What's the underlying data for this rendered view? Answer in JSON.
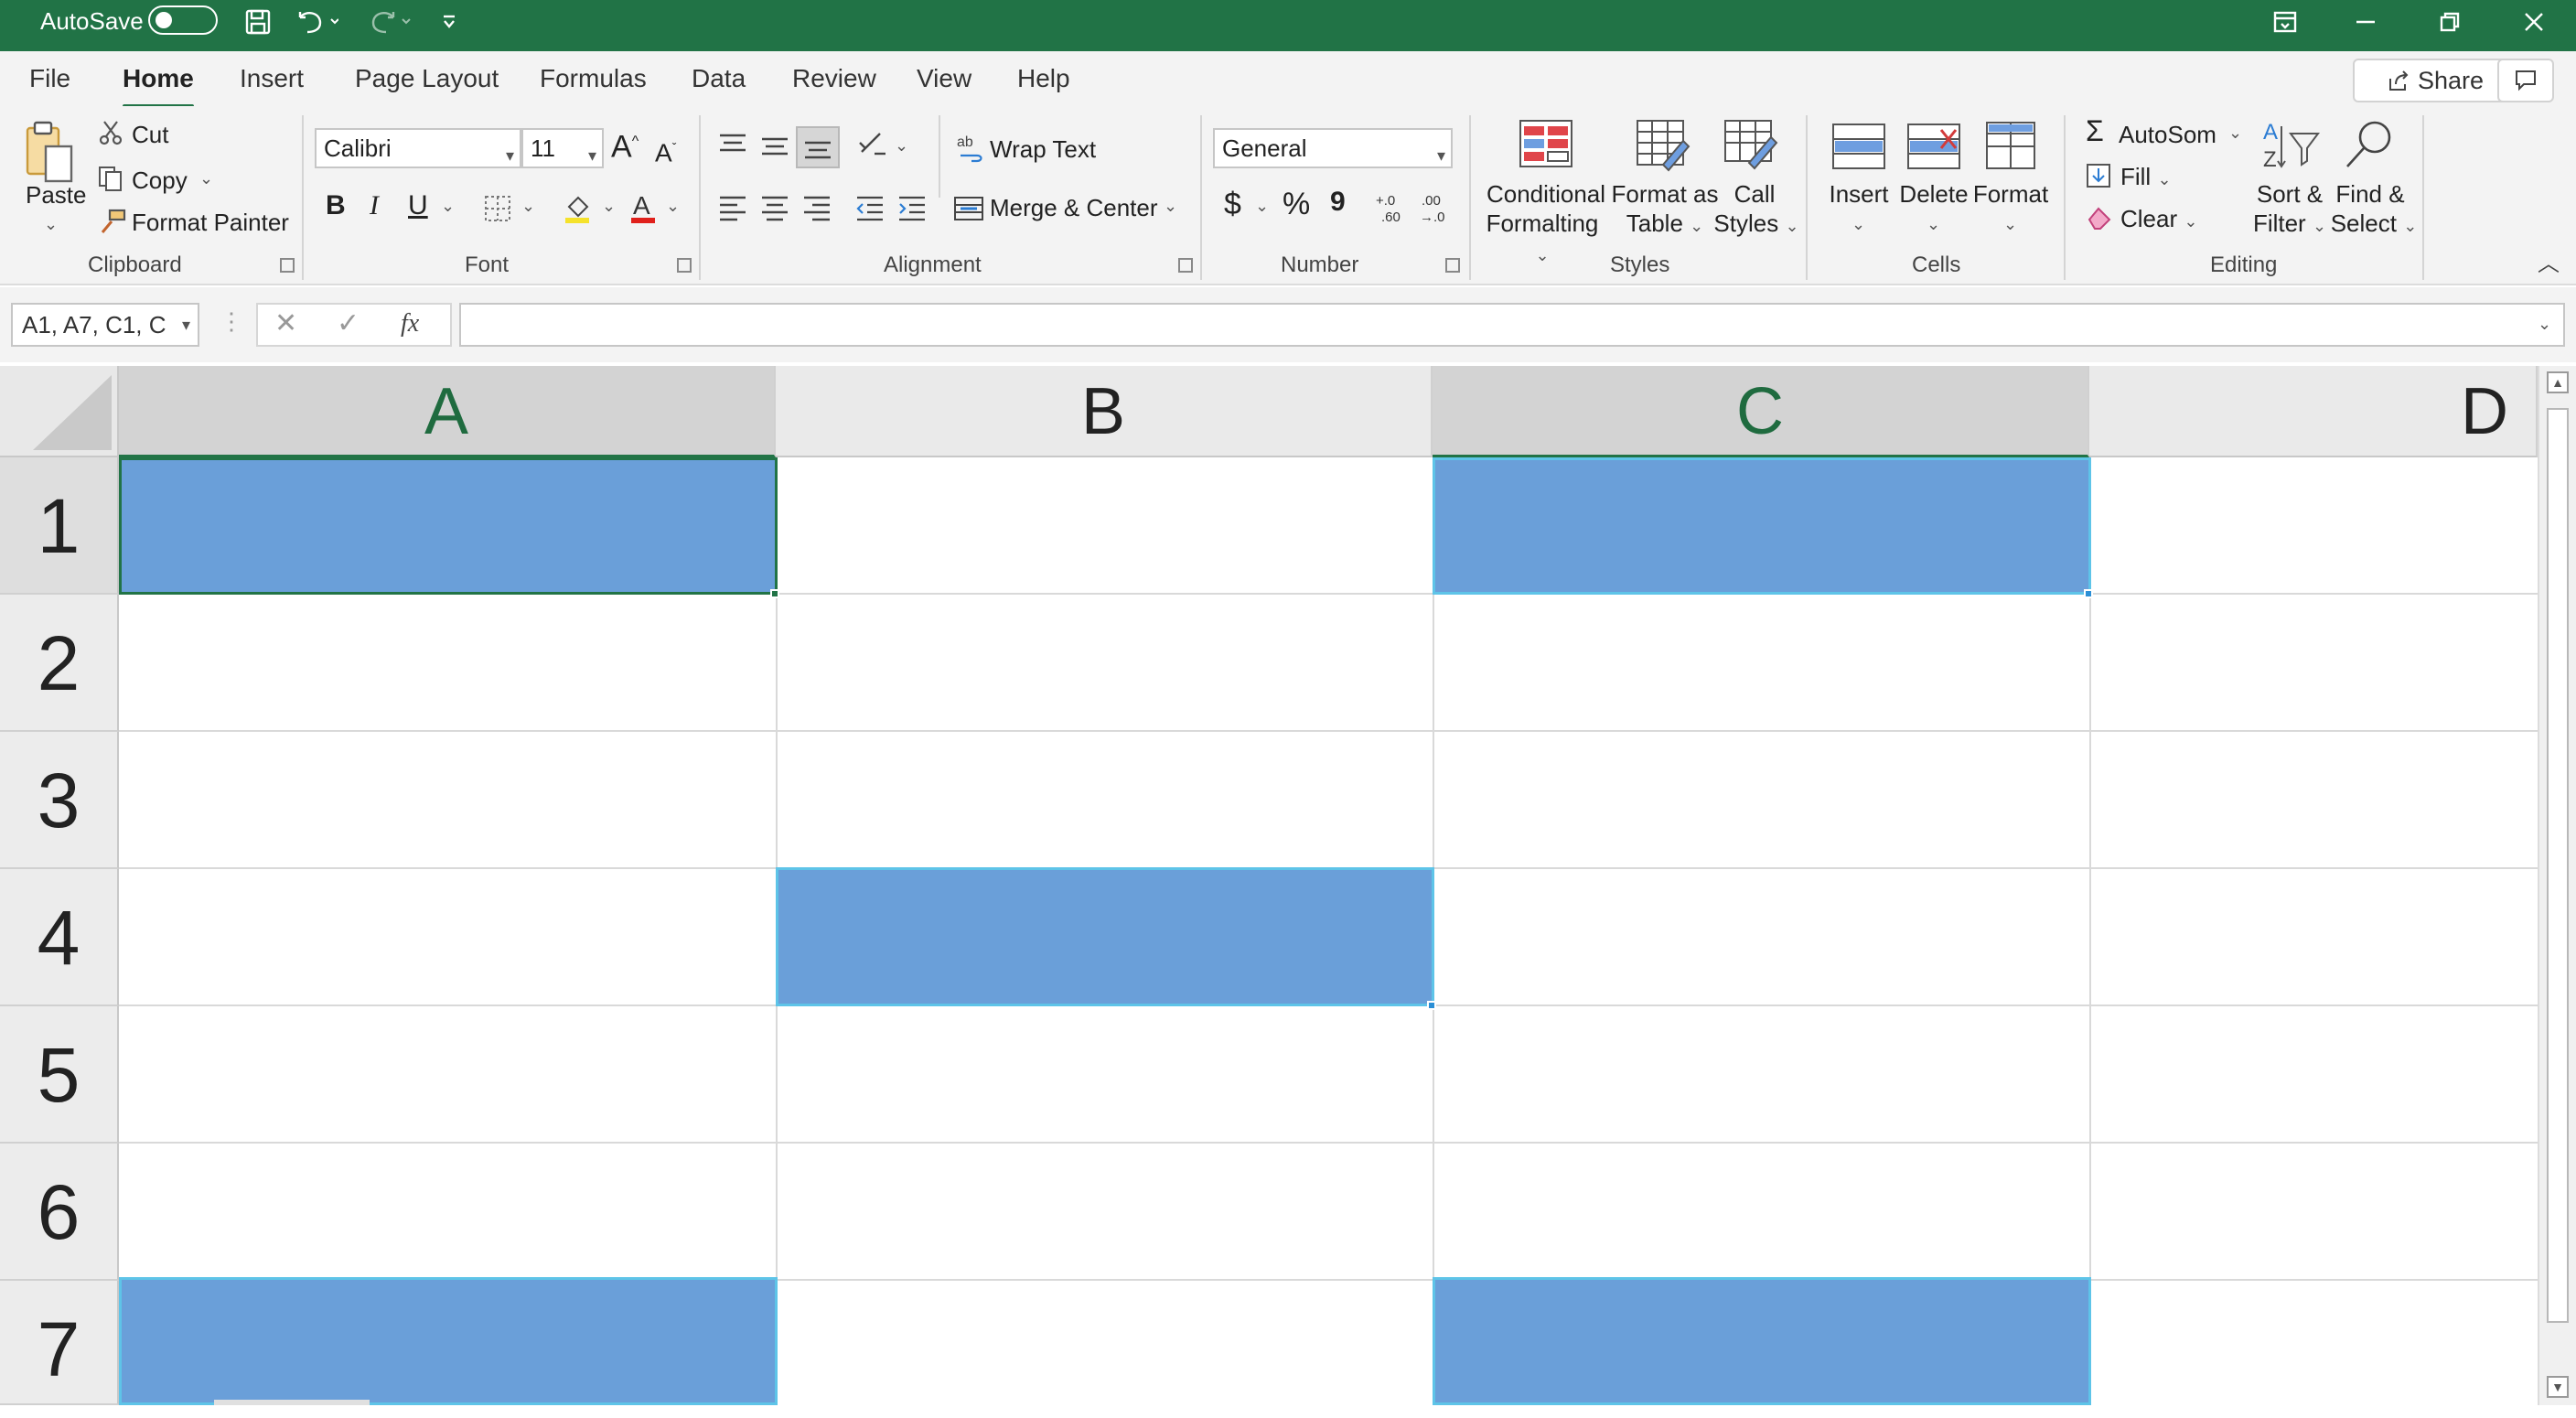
{
  "titlebar": {
    "autosave_label": "AutoSave",
    "autosave_state": "off",
    "qat_icons": [
      "save-icon",
      "undo-icon",
      "redo-icon",
      "customize-qat-icon"
    ],
    "window_icons": [
      "ribbon-display-icon",
      "minimize-icon",
      "restore-icon",
      "close-icon"
    ],
    "color": "#217346"
  },
  "tabs": {
    "items": [
      "File",
      "Home",
      "Insert",
      "Page Layout",
      "Formulas",
      "Data",
      "Review",
      "View",
      "Help"
    ],
    "active": "Home",
    "share_label": "Share"
  },
  "ribbon": {
    "clipboard": {
      "paste": "Paste",
      "cut": "Cut",
      "copy": "Copy",
      "format_painter": "Format Painter",
      "group_label": "Clipboard"
    },
    "font": {
      "font_name": "Calibri",
      "font_size": "11",
      "bold": "B",
      "italic": "I",
      "underline": "U",
      "grow": "A",
      "shrink": "A",
      "fill_label": "◇",
      "font_color": "A",
      "group_label": "Font"
    },
    "alignment": {
      "wrap_text": "Wrap Text",
      "merge_center": "Merge & Center",
      "group_label": "Alignment"
    },
    "number": {
      "format": "General",
      "currency": "$",
      "percent": "%",
      "comma": "9",
      "inc_decimal": "+.0\n.60",
      "dec_decimal": ".00\n→.0",
      "group_label": "Number"
    },
    "styles": {
      "conditional_line1": "Conditional",
      "conditional_line2": "Formalting",
      "format_table_line1": "Format as",
      "format_table_line2": "Table",
      "cell_styles_line1": "Call",
      "cell_styles_line2": "Styles",
      "group_label": "Styles"
    },
    "cells": {
      "insert": "Insert",
      "delete": "Delete",
      "format": "Format",
      "group_label": "Cells"
    },
    "editing": {
      "autosum": "AutoSom",
      "fill": "Fill",
      "clear": "Clear",
      "sort_line1": "Sort &",
      "sort_line2": "Filter",
      "find_line1": "Find &",
      "find_line2": "Select",
      "group_label": "Editing"
    }
  },
  "formula_bar": {
    "name_box": "A1, A7, C1, C",
    "fx": "fx",
    "cancel": "✕",
    "enter": "✓",
    "formula": ""
  },
  "sheet": {
    "columns": [
      "A",
      "B",
      "C",
      "D"
    ],
    "selected_columns": [
      "A",
      "C"
    ],
    "rows": [
      "1",
      "2",
      "3",
      "4",
      "5",
      "6",
      "7"
    ],
    "selected_rows": [
      "1"
    ],
    "selection_fill": "#6a9fd9",
    "selected_cells": [
      "A1",
      "C1",
      "B4",
      "A7",
      "C7"
    ],
    "active_cell": "A1"
  }
}
